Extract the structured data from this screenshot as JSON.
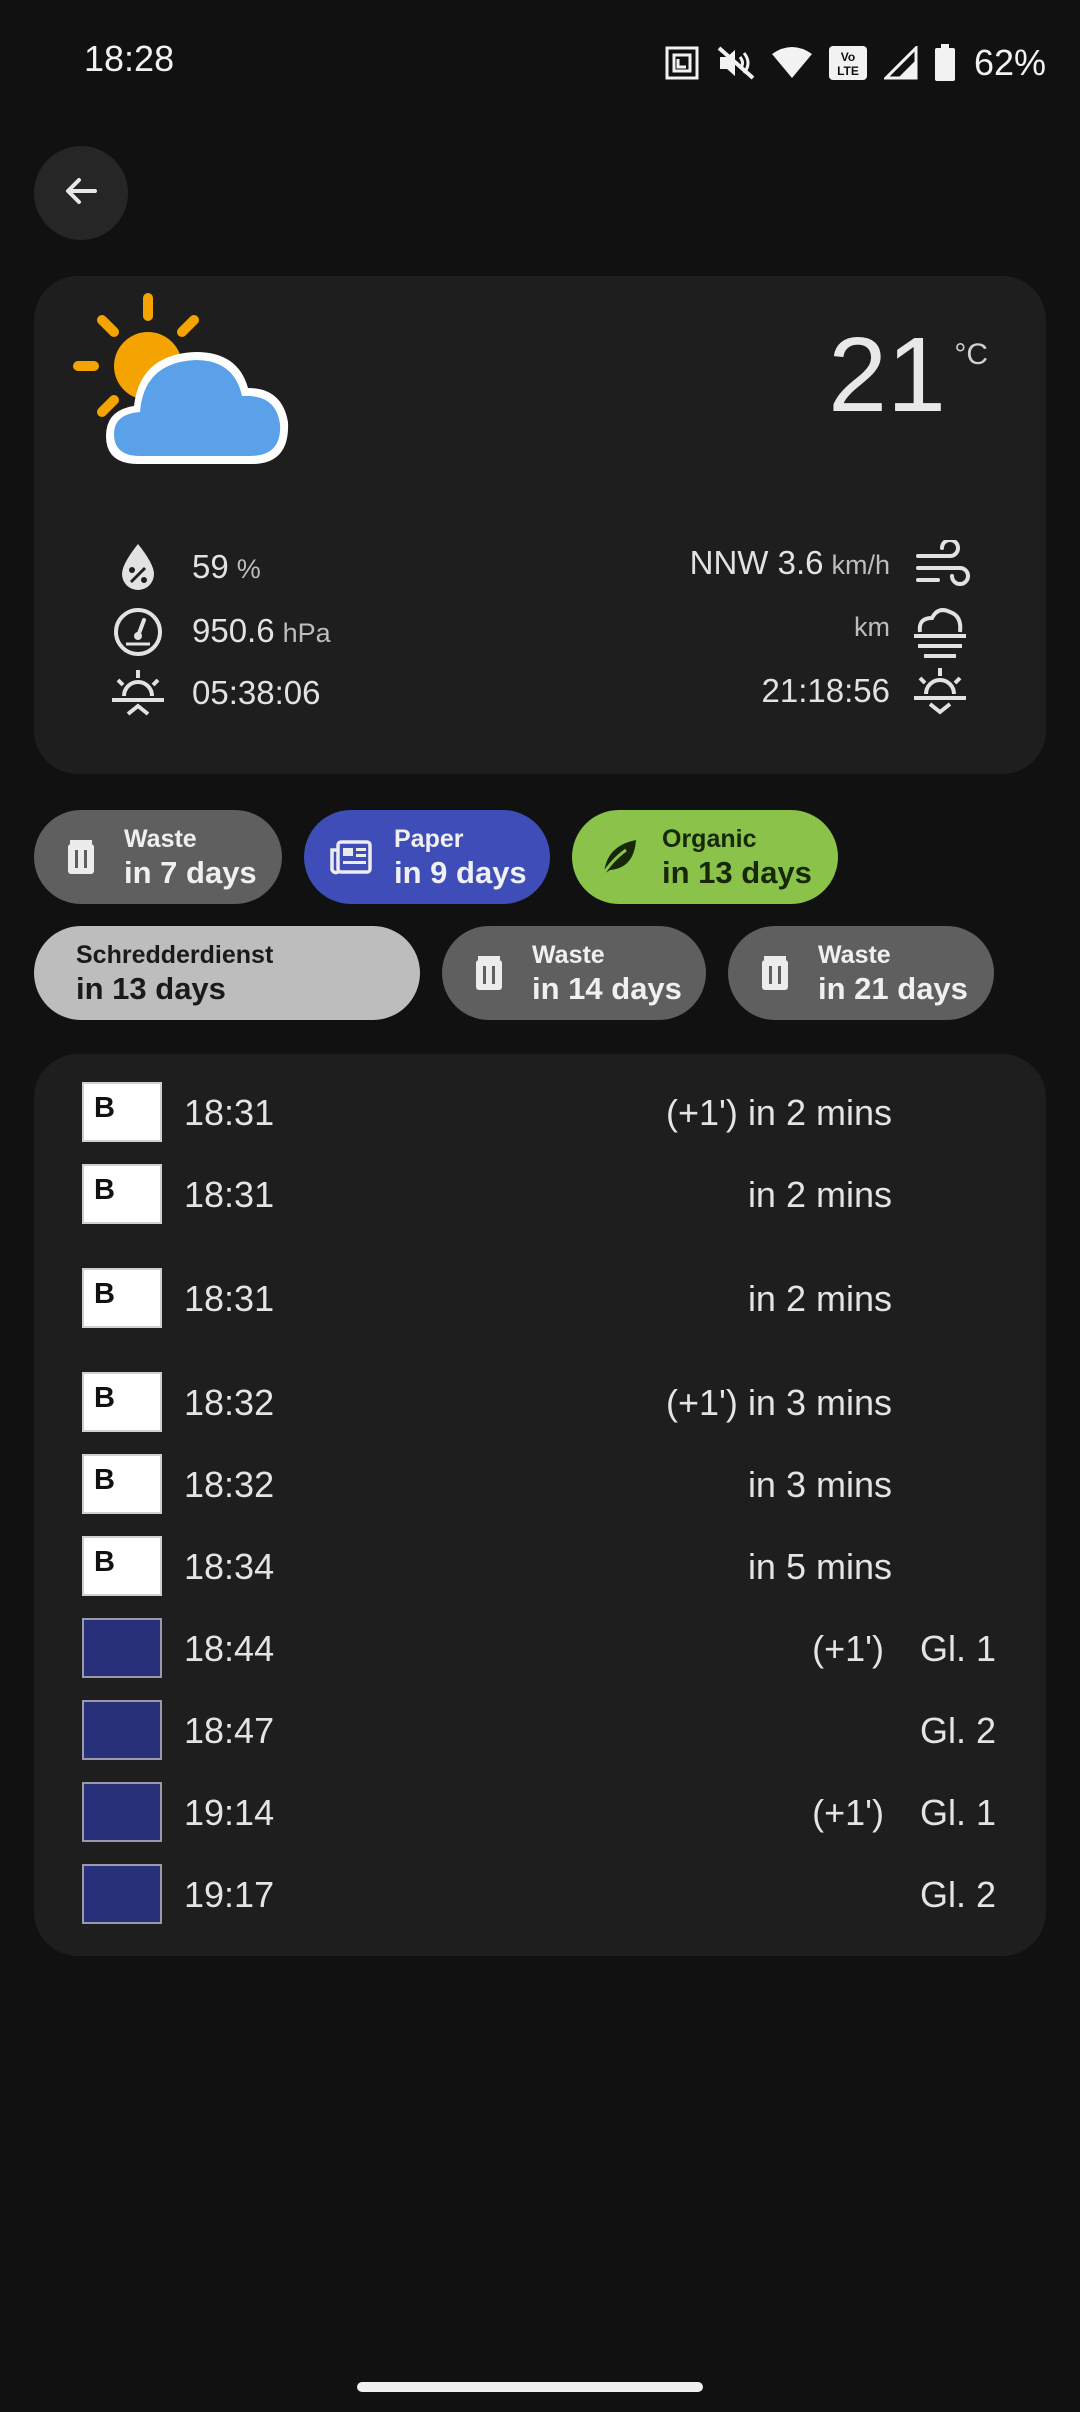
{
  "status_bar": {
    "time": "18:28",
    "network_badge": "Vo LTE",
    "battery_percent": "62%",
    "icons": [
      "nfc-icon",
      "mute-icon",
      "wifi-icon",
      "volte-icon",
      "signal-icon",
      "battery-icon"
    ]
  },
  "back_icon": "arrow-left-icon",
  "weather": {
    "condition_icon": "partly-cloudy-icon",
    "temperature": "21",
    "temperature_unit": "°C",
    "humidity": {
      "value": "59",
      "unit": "%"
    },
    "pressure": {
      "value": "950.6",
      "unit": "hPa"
    },
    "sunrise": "05:38:06",
    "wind": {
      "value": "NNW 3.6",
      "unit": "km/h"
    },
    "visibility": {
      "value": "",
      "unit": "km"
    },
    "sunset": "21:18:56"
  },
  "chips": [
    {
      "line1": "Waste",
      "line2": "in 7 days",
      "icon": "trash-icon",
      "color": "#5f5f5f"
    },
    {
      "line1": "Paper",
      "line2": "in 9 days",
      "icon": "newspaper-icon",
      "color": "#3e4db8"
    },
    {
      "line1": "Organic",
      "line2": "in 13 days",
      "icon": "leaf-icon",
      "color": "#8bc34a"
    },
    {
      "line1": "Schredderdienst",
      "line2": "in 13 days",
      "icon": "",
      "color": "#bdbdbd"
    },
    {
      "line1": "Waste",
      "line2": "in 14 days",
      "icon": "trash-icon",
      "color": "#5f5f5f"
    },
    {
      "line1": "Waste",
      "line2": "in 21 days",
      "icon": "trash-icon",
      "color": "#5f5f5f"
    }
  ],
  "departures": [
    {
      "badge": "B",
      "time": "18:31",
      "delay": "(+1')",
      "info": "in 2 mins"
    },
    {
      "badge": "B",
      "time": "18:31",
      "delay": "",
      "info": "in 2 mins"
    },
    {
      "badge": "B",
      "time": "18:31",
      "delay": "",
      "info": "in 2 mins"
    },
    {
      "badge": "B",
      "time": "18:32",
      "delay": "(+1')",
      "info": "in 3 mins"
    },
    {
      "badge": "B",
      "time": "18:32",
      "delay": "",
      "info": "in 3 mins"
    },
    {
      "badge": "B",
      "time": "18:34",
      "delay": "",
      "info": "in 5 mins"
    },
    {
      "badge": "",
      "time": "18:44",
      "delay": "(+1')",
      "info": "Gl. 1"
    },
    {
      "badge": "",
      "time": "18:47",
      "delay": "",
      "info": "Gl. 2"
    },
    {
      "badge": "",
      "time": "19:14",
      "delay": "(+1')",
      "info": "Gl. 1"
    },
    {
      "badge": "",
      "time": "19:17",
      "delay": "",
      "info": "Gl. 2"
    }
  ]
}
